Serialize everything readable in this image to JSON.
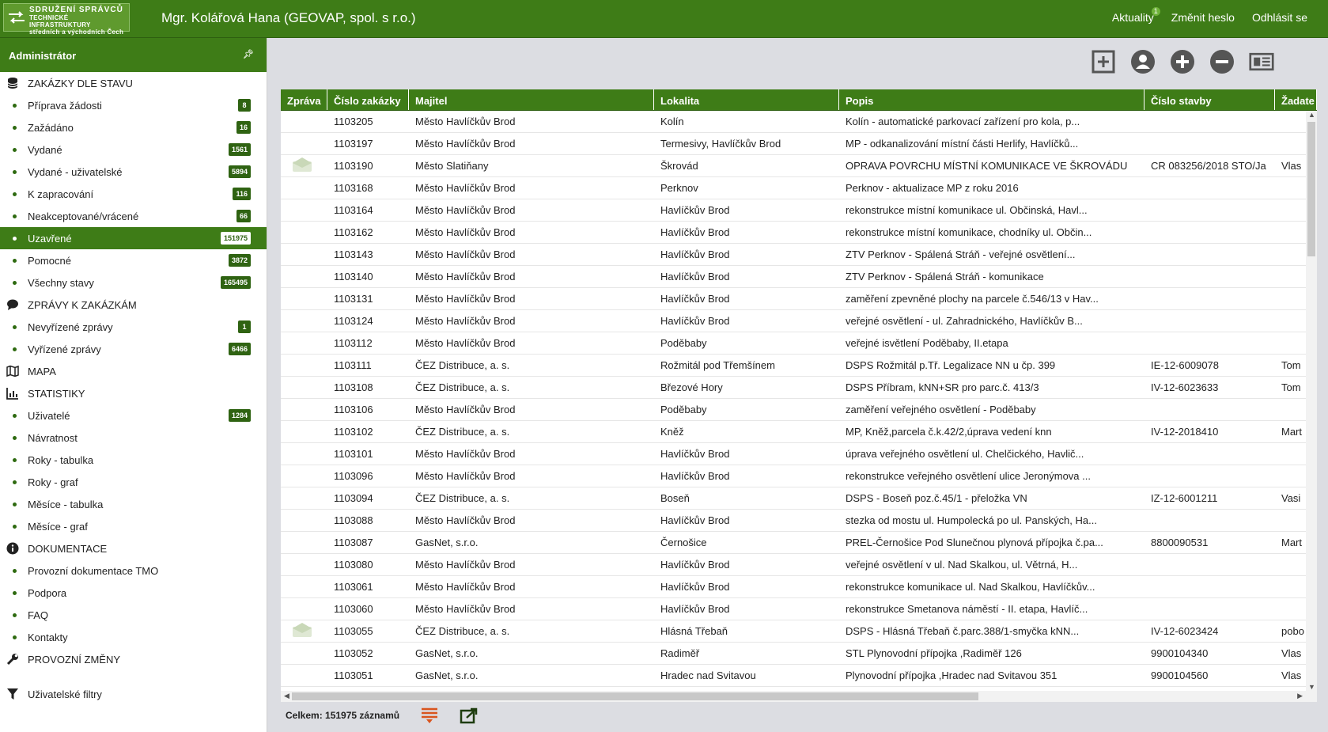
{
  "brand": {
    "logo_line1": "SDRUŽENÍ SPRÁVCŮ",
    "logo_line2": "TECHNICKÉ INFRASTRUKTURY",
    "logo_line3": "středních a východních Čech"
  },
  "topbar": {
    "user": "Mgr. Kolářová Hana (GEOVAP, spol. s r.o.)",
    "news_label": "Aktuality",
    "news_count": "1",
    "change_password": "Změnit heslo",
    "logout": "Odhlásit se"
  },
  "sidebar": {
    "title": "Administrátor",
    "groups": [
      {
        "label": "ZAKÁZKY DLE STAVU",
        "icon": "database-icon"
      },
      {
        "label": "ZPRÁVY K ZAKÁZKÁM",
        "icon": "speech-bubble-icon"
      },
      {
        "label": "MAPA",
        "icon": "map-icon"
      },
      {
        "label": "STATISTIKY",
        "icon": "bar-chart-icon"
      },
      {
        "label": "DOKUMENTACE",
        "icon": "info-icon"
      },
      {
        "label": "PROVOZNÍ ZMĚNY",
        "icon": "wrench-icon"
      },
      {
        "label": "Uživatelské filtry",
        "icon": "filter-icon"
      }
    ],
    "orders": [
      {
        "label": "Příprava žádosti",
        "count": "8"
      },
      {
        "label": "Zažádáno",
        "count": "16"
      },
      {
        "label": "Vydané",
        "count": "1561"
      },
      {
        "label": "Vydané - uživatelské",
        "count": "5894"
      },
      {
        "label": "K zapracování",
        "count": "116"
      },
      {
        "label": "Neakceptované/vrácené",
        "count": "66"
      },
      {
        "label": "Uzavřené",
        "count": "151975"
      },
      {
        "label": "Pomocné",
        "count": "3872"
      },
      {
        "label": "Všechny stavy",
        "count": "165495"
      }
    ],
    "messages": [
      {
        "label": "Nevyřízené zprávy",
        "count": "1"
      },
      {
        "label": "Vyřízené zprávy",
        "count": "6466"
      }
    ],
    "stats": [
      {
        "label": "Uživatelé",
        "count": "1284"
      },
      {
        "label": "Návratnost"
      },
      {
        "label": "Roky - tabulka"
      },
      {
        "label": "Roky - graf"
      },
      {
        "label": "Měsíce - tabulka"
      },
      {
        "label": "Měsíce - graf"
      }
    ],
    "docs": [
      {
        "label": "Provozní dokumentace TMO"
      },
      {
        "label": "Podpora"
      },
      {
        "label": "FAQ"
      },
      {
        "label": "Kontakty"
      }
    ]
  },
  "toolbar": [
    "add-box-icon",
    "user-circle-icon",
    "plus-circle-icon",
    "minus-circle-icon",
    "news-icon"
  ],
  "table": {
    "columns": [
      "Zpráva",
      "Číslo zakázky",
      "Majitel",
      "Lokalita",
      "Popis",
      "Číslo stavby",
      "Žadate"
    ],
    "rows": [
      {
        "msg": false,
        "id": "1103205",
        "owner": "Město Havlíčkův Brod",
        "loc": "Kolín",
        "desc": "Kolín - automatické parkovací zařízení pro kola, p...",
        "build": "",
        "req": ""
      },
      {
        "msg": false,
        "id": "1103197",
        "owner": "Město Havlíčkův Brod",
        "loc": "Termesivy, Havlíčkův Brod",
        "desc": "MP - odkanalizování místní části Herlify, Havlíčků...",
        "build": "",
        "req": ""
      },
      {
        "msg": true,
        "id": "1103190",
        "owner": "Město Slatiňany",
        "loc": "Škrovád",
        "desc": "OPRAVA POVRCHU MÍSTNÍ KOMUNIKACE  VE ŠKROVÁDU",
        "build": "CR 083256/2018 STO/Ja",
        "req": "Vlas"
      },
      {
        "msg": false,
        "id": "1103168",
        "owner": "Město Havlíčkův Brod",
        "loc": "Perknov",
        "desc": "Perknov - aktualizace MP z roku 2016",
        "build": "",
        "req": ""
      },
      {
        "msg": false,
        "id": "1103164",
        "owner": "Město Havlíčkův Brod",
        "loc": "Havlíčkův Brod",
        "desc": "rekonstrukce místní komunikace  ul. Občinská, Havl...",
        "build": "",
        "req": ""
      },
      {
        "msg": false,
        "id": "1103162",
        "owner": "Město Havlíčkův Brod",
        "loc": "Havlíčkův Brod",
        "desc": "rekonstrukce místní komunikace, chodníky ul. Občin...",
        "build": "",
        "req": ""
      },
      {
        "msg": false,
        "id": "1103143",
        "owner": "Město Havlíčkův Brod",
        "loc": "Havlíčkův Brod",
        "desc": "ZTV Perknov - Spálená Stráň - veřejné osvětlení...",
        "build": "",
        "req": ""
      },
      {
        "msg": false,
        "id": "1103140",
        "owner": "Město Havlíčkův Brod",
        "loc": "Havlíčkův Brod",
        "desc": "ZTV Perknov - Spálená Stráň - komunikace",
        "build": "",
        "req": ""
      },
      {
        "msg": false,
        "id": "1103131",
        "owner": "Město Havlíčkův Brod",
        "loc": "Havlíčkův Brod",
        "desc": "zaměření zpevněné plochy na parcele č.546/13 v Hav...",
        "build": "",
        "req": ""
      },
      {
        "msg": false,
        "id": "1103124",
        "owner": "Město Havlíčkův Brod",
        "loc": "Havlíčkův Brod",
        "desc": "veřejné osvětlení - ul. Zahradnického, Havlíčkův B...",
        "build": "",
        "req": ""
      },
      {
        "msg": false,
        "id": "1103112",
        "owner": "Město Havlíčkův Brod",
        "loc": "Poděbaby",
        "desc": "veřejné isvětlení Poděbaby, II.etapa",
        "build": "",
        "req": ""
      },
      {
        "msg": false,
        "id": "1103111",
        "owner": "ČEZ Distribuce, a. s.",
        "loc": "Rožmitál pod Třemšínem",
        "desc": "DSPS Rožmitál p.Tř. Legalizace NN u čp. 399",
        "build": "IE-12-6009078",
        "req": "Tom"
      },
      {
        "msg": false,
        "id": "1103108",
        "owner": "ČEZ Distribuce, a. s.",
        "loc": "Březové Hory",
        "desc": "DSPS Příbram, kNN+SR pro parc.č. 413/3",
        "build": "IV-12-6023633",
        "req": "Tom"
      },
      {
        "msg": false,
        "id": "1103106",
        "owner": "Město Havlíčkův Brod",
        "loc": "Poděbaby",
        "desc": "zaměření veřejného osvětlení - Poděbaby",
        "build": "",
        "req": ""
      },
      {
        "msg": false,
        "id": "1103102",
        "owner": "ČEZ Distribuce, a. s.",
        "loc": "Kněž",
        "desc": "MP, Kněž,parcela č.k.42/2,úprava vedení knn",
        "build": "IV-12-2018410",
        "req": "Mart"
      },
      {
        "msg": false,
        "id": "1103101",
        "owner": "Město Havlíčkův Brod",
        "loc": "Havlíčkův Brod",
        "desc": "úprava veřejného osvětlení ul. Chelčického, Havlič...",
        "build": "",
        "req": ""
      },
      {
        "msg": false,
        "id": "1103096",
        "owner": "Město Havlíčkův Brod",
        "loc": "Havlíčkův Brod",
        "desc": "rekonstrukce veřejného osvětlení ulice Jeronýmova ...",
        "build": "",
        "req": ""
      },
      {
        "msg": false,
        "id": "1103094",
        "owner": "ČEZ Distribuce, a. s.",
        "loc": "Boseň",
        "desc": "DSPS - Boseň poz.č.45/1 - přeložka VN",
        "build": "IZ-12-6001211",
        "req": "Vasi"
      },
      {
        "msg": false,
        "id": "1103088",
        "owner": "Město Havlíčkův Brod",
        "loc": "Havlíčkův Brod",
        "desc": "stezka od mostu ul. Humpolecká po ul. Panských, Ha...",
        "build": "",
        "req": ""
      },
      {
        "msg": false,
        "id": "1103087",
        "owner": "GasNet, s.r.o.",
        "loc": "Černošice",
        "desc": "PREL-Černošice Pod Slunečnou plynová přípojka č.pa...",
        "build": "8800090531",
        "req": "Mart"
      },
      {
        "msg": false,
        "id": "1103080",
        "owner": "Město Havlíčkův Brod",
        "loc": "Havlíčkův Brod",
        "desc": "veřejné osvětlení v ul. Nad Skalkou, ul. Větrná, H...",
        "build": "",
        "req": ""
      },
      {
        "msg": false,
        "id": "1103061",
        "owner": "Město Havlíčkův Brod",
        "loc": "Havlíčkův Brod",
        "desc": "rekonstrukce komunikace ul. Nad Skalkou, Havlíčkův...",
        "build": "",
        "req": ""
      },
      {
        "msg": false,
        "id": "1103060",
        "owner": "Město Havlíčkův Brod",
        "loc": "Havlíčkův Brod",
        "desc": "rekonstrukce Smetanova náměstí - II. etapa, Havlíč...",
        "build": "",
        "req": ""
      },
      {
        "msg": true,
        "id": "1103055",
        "owner": "ČEZ Distribuce, a. s.",
        "loc": "Hlásná Třebaň",
        "desc": "DSPS - Hlásná Třebaň č.parc.388/1-smyčka kNN...",
        "build": "IV-12-6023424",
        "req": "pobo"
      },
      {
        "msg": false,
        "id": "1103052",
        "owner": "GasNet, s.r.o.",
        "loc": "Radiměř",
        "desc": "STL Plynovodní přípojka ,Radiměř  126",
        "build": "9900104340",
        "req": "Vlas"
      },
      {
        "msg": false,
        "id": "1103051",
        "owner": "GasNet, s.r.o.",
        "loc": "Hradec nad Svitavou",
        "desc": "Plynovodní přípojka ,Hradec nad Svitavou  351",
        "build": "9900104560",
        "req": "Vlas"
      }
    ]
  },
  "footer": {
    "total_label": "Celkem: 151975 záznamů"
  },
  "colors": {
    "primary_green": "#3e7c17",
    "badge_green": "#2f6312",
    "background": "#dcdde2"
  }
}
